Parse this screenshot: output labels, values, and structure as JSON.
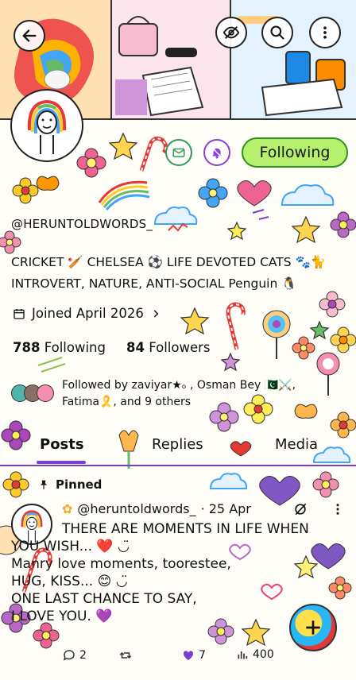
{
  "header": {
    "back_icon": "arrow-left-icon",
    "hide_icon": "eye-off-icon",
    "search_icon": "search-icon",
    "more_icon": "more-vertical-icon"
  },
  "profile_actions": {
    "message_icon": "mail-icon",
    "notify_icon": "bell-off-icon",
    "following_label": "Following"
  },
  "profile": {
    "handle": "@HERUNTOLDWORDS_",
    "bio_line1": "CRICKET 🏏 CHELSEA ⚽ LIFE DEVOTED CATS 🐾🐈",
    "bio_line2": "INTROVERT, NATURE, ANTI-SOCIAL Penguin 🐧",
    "joined": "Joined April 2026",
    "following_count": "788",
    "following_label": "Following",
    "followers_count": "84",
    "followers_label": "Followers",
    "followed_by_line1": "Followed by zaviyar★ₒ , Osman Bey 🇵🇰⚔️,",
    "followed_by_line2": "Fatima🎗️, and 9 others"
  },
  "tabs": [
    {
      "label": "Posts",
      "active": true
    },
    {
      "label": "Replies",
      "active": false
    },
    {
      "label": "Media",
      "active": false
    }
  ],
  "post": {
    "pinned_label": "Pinned",
    "author": "@heruntoldwords_",
    "date": "· 25 Apr",
    "lines": [
      "THERE ARE MOMENTS IN LIFE WHEN",
      "YOU WISH... ❤️ ◡̈",
      "Manry love moments, toorestee,",
      "HUG, KISS... 😊 ◡̈",
      "ONE LAST CHANCE TO SAY,",
      "I LOVE YOU. 💜"
    ],
    "replies": "2",
    "likes": "7",
    "views": "400"
  },
  "colors": {
    "accent_purple": "#7b3fd0",
    "follow_green": "#b7ef6f",
    "follow_border": "#2f8f1f",
    "mail_green": "#2e9d4f",
    "bell_purple": "#8a3fd6"
  }
}
